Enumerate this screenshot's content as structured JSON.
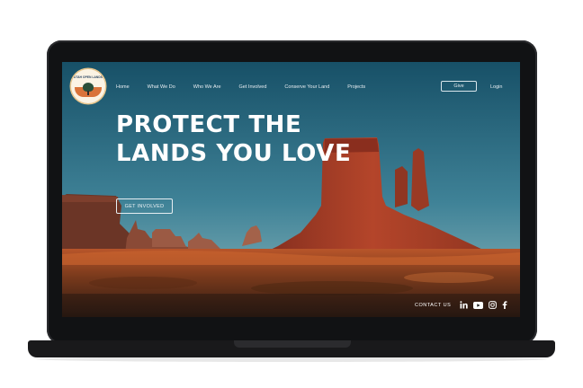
{
  "logo": {
    "text": "UTAH OPEN LANDS"
  },
  "nav": {
    "items": [
      "Home",
      "What We Do",
      "Who We Are",
      "Get Involved",
      "Conserve Your Land",
      "Projects"
    ],
    "give_label": "Give",
    "login_label": "Login"
  },
  "hero": {
    "title": "PROTECT THE LANDS YOU LOVE",
    "cta_label": "GET INVOLVED"
  },
  "footer": {
    "contact_label": "CONTACT US",
    "social": [
      "linkedin-icon",
      "youtube-icon",
      "instagram-icon",
      "facebook-icon"
    ]
  },
  "colors": {
    "sky_top": "#175067",
    "sky_bottom": "#6fa6b1",
    "rock": "#b4452a",
    "ground": "#9a4a22"
  }
}
